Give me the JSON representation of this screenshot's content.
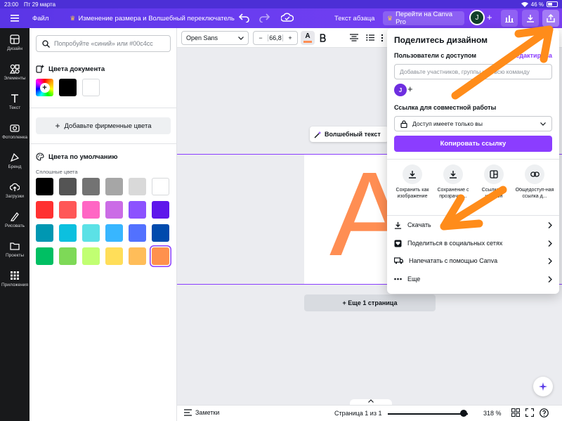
{
  "status_bar": {
    "time": "23:00",
    "date": "Пт 29 марта",
    "battery": "46 %"
  },
  "topbar": {
    "file_label": "Файл",
    "design_title": "Изменение размера и Волшебный переключатель",
    "text_style": "Текст абзаца",
    "upgrade_label": "Перейти на Canva Pro",
    "avatar_initial": "J"
  },
  "rail": {
    "items": [
      {
        "label": "Дизайн",
        "icon": "design-icon"
      },
      {
        "label": "Элементы",
        "icon": "elements-icon"
      },
      {
        "label": "Текст",
        "icon": "text-icon"
      },
      {
        "label": "Фотопленка",
        "icon": "camera-roll-icon"
      },
      {
        "label": "Бренд",
        "icon": "brand-icon"
      },
      {
        "label": "Загрузки",
        "icon": "uploads-icon"
      },
      {
        "label": "Рисовать",
        "icon": "draw-icon"
      },
      {
        "label": "Проекты",
        "icon": "projects-icon"
      },
      {
        "label": "Приложения",
        "icon": "apps-icon"
      }
    ]
  },
  "panel": {
    "search_placeholder": "Попробуйте «синий» или #00c4cc",
    "doc_colors_title": "Цвета документа",
    "doc_colors": [
      "#000000",
      "#ffffff"
    ],
    "add_brand_label": "Добавьте фирменные цвета",
    "default_colors_title": "Цвета по умолчанию",
    "solid_label": "Сплошные цвета",
    "palette": [
      [
        "#000000",
        "#545454",
        "#737373",
        "#a6a6a6",
        "#d9d9d9",
        "#ffffff"
      ],
      [
        "#ff3131",
        "#ff5757",
        "#ff66c4",
        "#cb6ce6",
        "#8c52ff",
        "#5e17eb"
      ],
      [
        "#0097b2",
        "#0cc0df",
        "#5ce1e6",
        "#38b6ff",
        "#5271ff",
        "#004aad"
      ],
      [
        "#00bf63",
        "#7ed957",
        "#c1ff72",
        "#ffde59",
        "#ffbd59",
        "#ff914d"
      ]
    ]
  },
  "toolbar": {
    "font_name": "Open Sans",
    "font_size": "66,8",
    "minus": "−",
    "plus": "+",
    "text_color_glyph": "A",
    "text_color": "#ff8e53"
  },
  "canvas": {
    "magic_text_label": "Волшебный текст",
    "letter": "A",
    "letter_color": "#ff8e53",
    "add_page_label": "+ Еще 1 страница"
  },
  "bottombar": {
    "notes_label": "Заметки",
    "page_label": "Страница 1 из 1",
    "zoom": "318 %",
    "zoom_fraction": 0.95
  },
  "share": {
    "title": "Поделитесь дизайном",
    "access_label": "Пользователи с доступом",
    "edit_label": "Редактирова",
    "add_placeholder": "Добавьте участников, группы или всю команду",
    "avatar_initial": "J",
    "link_label": "Ссылка для совместной работы",
    "link_value": "Доступ имеете только вы",
    "copy_label": "Копировать ссылку",
    "options": [
      {
        "label": "Сохранить как изображение",
        "icon": "download-icon"
      },
      {
        "label": "Сохранение с прозрачно...",
        "icon": "download-transparent-icon"
      },
      {
        "label": "Ссылка на шаблон",
        "icon": "template-link-icon"
      },
      {
        "label": "Общедоступ-ная ссылка д...",
        "icon": "link-icon"
      }
    ],
    "menu": [
      {
        "label": "Скачать",
        "icon": "download-icon"
      },
      {
        "label": "Поделиться в социальных сетях",
        "icon": "heart-icon"
      },
      {
        "label": "Напечатать с помощью Canva",
        "icon": "truck-icon"
      },
      {
        "label": "Еще",
        "icon": "more-icon"
      }
    ]
  },
  "colors": {
    "accent": "#8b3dff",
    "topbar": "#6a3df0",
    "annotation": "#ff8c1a"
  }
}
